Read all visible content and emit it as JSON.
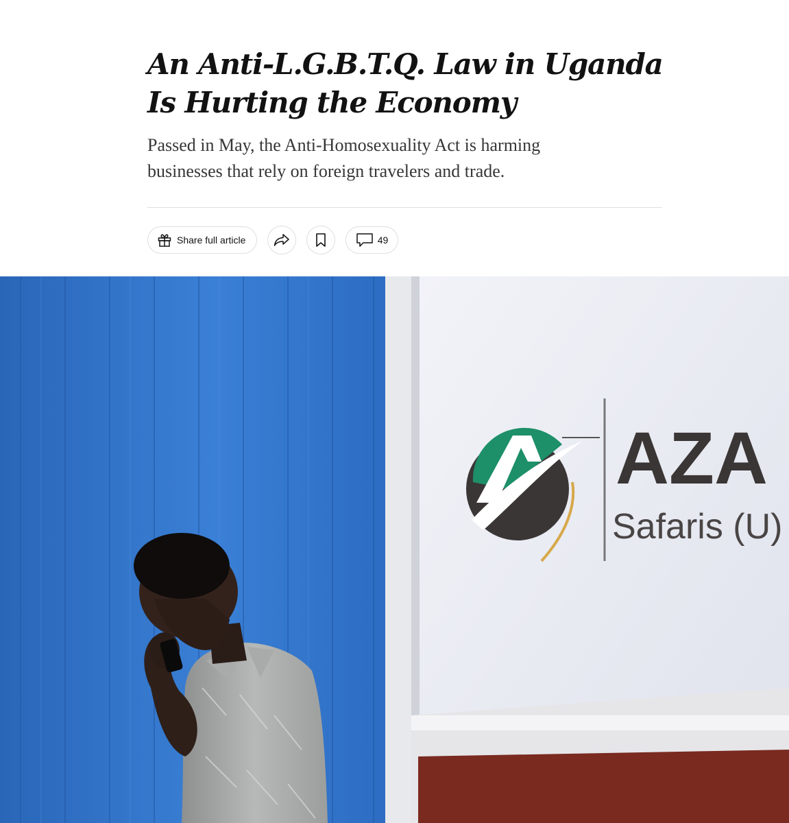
{
  "article": {
    "headline": "An Anti-L.G.B.T.Q. Law in Uganda Is Hurting the Economy",
    "summary": "Passed in May, the Anti-Homosexuality Act is harming businesses that rely on foreign travelers and trade."
  },
  "toolbar": {
    "share_label": "Share full article",
    "share_icon": "gift-icon",
    "forward_icon": "share-arrow-icon",
    "save_icon": "bookmark-icon",
    "comments_icon": "comment-bubble-icon",
    "comments_count": "49"
  },
  "photo": {
    "sign_wordmark": "AZA",
    "sign_subtitle": "Safaris (U)",
    "colors": {
      "wall_blue": "#2d6fc6",
      "sign_white": "#e9ecf3",
      "logo_green": "#1a8f6a",
      "logo_dark": "#3a3434"
    }
  }
}
